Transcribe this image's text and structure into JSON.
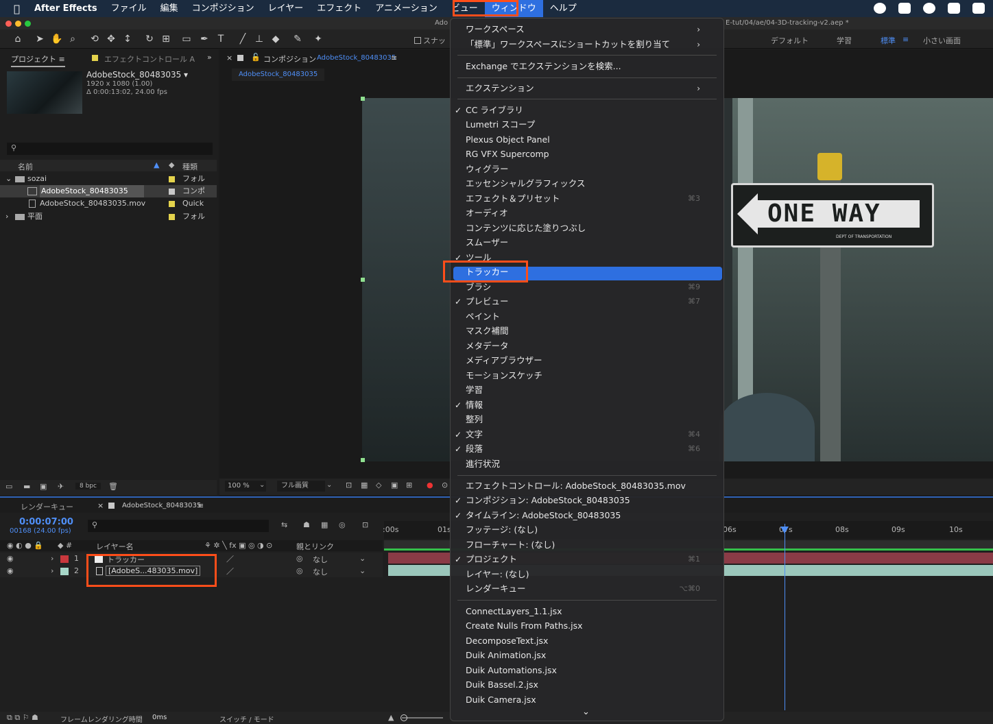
{
  "menubar": {
    "app": "After Effects",
    "items": [
      "ファイル",
      "編集",
      "コンポジション",
      "レイヤー",
      "エフェクト",
      "アニメーション",
      "ビュー",
      "ウィンドウ",
      "ヘルプ"
    ]
  },
  "window": {
    "title_left": "Ado",
    "title_right": "E-tut/04/ae/04-3D-tracking-v2.aep *"
  },
  "workspaces": [
    "デフォルト",
    "学習",
    "標準",
    "小さい画面"
  ],
  "snap_label": "スナッ",
  "project": {
    "tab": "プロジェクト",
    "tab2": "エフェクトコントロール A",
    "item_name": "AdobeStock_80483035 ▾",
    "item_res": "1920 x 1080 (1.00)",
    "item_dur": "Δ 0:00:13:02, 24.00 fps",
    "col_name": "名前",
    "col_type": "種類",
    "rows": [
      {
        "name": "sozai",
        "type": "フォル",
        "color": "#e4d34c"
      },
      {
        "name": "AdobeStock_80483035",
        "type": "コンポ",
        "color": "#c8c8c8"
      },
      {
        "name": "AdobeStock_80483035.mov",
        "type": "Quick",
        "color": "#e4d34c"
      },
      {
        "name": "平面",
        "type": "フォル",
        "color": "#e4d34c"
      }
    ],
    "bpc": "8 bpc"
  },
  "comp": {
    "tab_prefix": "コンポジション",
    "tab_name": "AdobeStock_80483035",
    "subtab": "AdobeStock_80483035",
    "zoom": "100 %",
    "quality": "フル画質",
    "sign": "ONE WAY",
    "sign_small": "DEPT OF TRANSPORTATION"
  },
  "menu": {
    "items": [
      {
        "label": "ワークスペース",
        "arrow": "›"
      },
      {
        "label": "「標準」ワークスペースにショートカットを割り当て",
        "arrow": "›"
      },
      {
        "label": "Exchange でエクステンションを検索..."
      },
      {
        "label": "エクステンション",
        "arrow": "›"
      },
      {
        "label": "CC ライブラリ",
        "check": "✓"
      },
      {
        "label": "Lumetri スコープ"
      },
      {
        "label": "Plexus Object Panel"
      },
      {
        "label": "RG VFX Supercomp"
      },
      {
        "label": "ウィグラー"
      },
      {
        "label": "エッセンシャルグラフィックス"
      },
      {
        "label": "エフェクト＆プリセット",
        "sc": "⌘3"
      },
      {
        "label": "オーディオ"
      },
      {
        "label": "コンテンツに応じた塗りつぶし"
      },
      {
        "label": "スムーザー"
      },
      {
        "label": "ツール",
        "check": "✓"
      },
      {
        "label": "トラッカー"
      },
      {
        "label": "ブラシ",
        "sc": "⌘9"
      },
      {
        "label": "プレビュー",
        "check": "✓",
        "sc": "⌘7"
      },
      {
        "label": "ペイント"
      },
      {
        "label": "マスク補間"
      },
      {
        "label": "メタデータ"
      },
      {
        "label": "メディアブラウザー"
      },
      {
        "label": "モーションスケッチ"
      },
      {
        "label": "学習"
      },
      {
        "label": "情報",
        "check": "✓"
      },
      {
        "label": "整列"
      },
      {
        "label": "文字",
        "check": "✓",
        "sc": "⌘4"
      },
      {
        "label": "段落",
        "check": "✓",
        "sc": "⌘6"
      },
      {
        "label": "進行状況"
      },
      {
        "label": "エフェクトコントロール: AdobeStock_80483035.mov"
      },
      {
        "label": "コンポジション: AdobeStock_80483035",
        "check": "✓"
      },
      {
        "label": "タイムライン: AdobeStock_80483035",
        "check": "✓"
      },
      {
        "label": "フッテージ: (なし)"
      },
      {
        "label": "フローチャート: (なし)"
      },
      {
        "label": "プロジェクト",
        "check": "✓",
        "sc": "⌘1"
      },
      {
        "label": "レイヤー: (なし)"
      },
      {
        "label": "レンダーキュー",
        "sc": "⌥⌘0"
      },
      {
        "label": "ConnectLayers_1.1.jsx"
      },
      {
        "label": "Create Nulls From Paths.jsx"
      },
      {
        "label": "DecomposeText.jsx"
      },
      {
        "label": "Duik Animation.jsx"
      },
      {
        "label": "Duik Automations.jsx"
      },
      {
        "label": "Duik Bassel.2.jsx"
      },
      {
        "label": "Duik Camera.jsx"
      }
    ],
    "more": "⌄"
  },
  "timeline": {
    "tab_render": "レンダーキュー",
    "tab_comp": "AdobeStock_80483035",
    "time": "0:00:07:00",
    "frames": "00168 (24.00 fps)",
    "col_layer": "レイヤー名",
    "col_parent": "親とリンク",
    "layers": [
      {
        "num": "1",
        "name": "トラッカー",
        "color": "#c8383d",
        "parent": "なし"
      },
      {
        "num": "2",
        "name": "[AdobeS...483035.mov]",
        "color": "#a7d6c8",
        "parent": "なし"
      }
    ],
    "ruler": [
      ":00s",
      "01s",
      "06s",
      "07s",
      "08s",
      "09s",
      "10s"
    ],
    "footer": "フレームレンダリング時間",
    "footer_val": "0ms",
    "switch_mode": "スイッチ / モード"
  },
  "colors": {
    "accent": "#2e6fe0",
    "highlight": "#ff4e1a"
  }
}
